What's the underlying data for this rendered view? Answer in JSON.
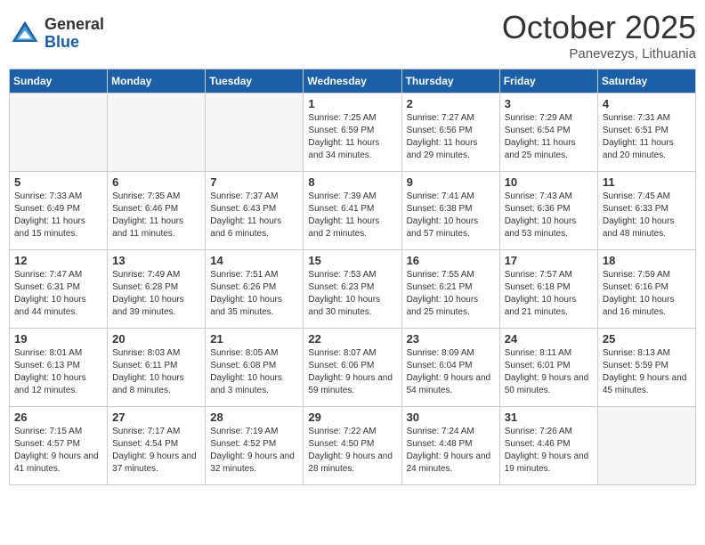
{
  "header": {
    "logo_general": "General",
    "logo_blue": "Blue",
    "month": "October 2025",
    "location": "Panevezys, Lithuania"
  },
  "weekdays": [
    "Sunday",
    "Monday",
    "Tuesday",
    "Wednesday",
    "Thursday",
    "Friday",
    "Saturday"
  ],
  "weeks": [
    [
      {
        "day": "",
        "empty": true
      },
      {
        "day": "",
        "empty": true
      },
      {
        "day": "",
        "empty": true
      },
      {
        "day": "1",
        "sunrise": "7:25 AM",
        "sunset": "6:59 PM",
        "daylight": "11 hours and 34 minutes."
      },
      {
        "day": "2",
        "sunrise": "7:27 AM",
        "sunset": "6:56 PM",
        "daylight": "11 hours and 29 minutes."
      },
      {
        "day": "3",
        "sunrise": "7:29 AM",
        "sunset": "6:54 PM",
        "daylight": "11 hours and 25 minutes."
      },
      {
        "day": "4",
        "sunrise": "7:31 AM",
        "sunset": "6:51 PM",
        "daylight": "11 hours and 20 minutes."
      }
    ],
    [
      {
        "day": "5",
        "sunrise": "7:33 AM",
        "sunset": "6:49 PM",
        "daylight": "11 hours and 15 minutes."
      },
      {
        "day": "6",
        "sunrise": "7:35 AM",
        "sunset": "6:46 PM",
        "daylight": "11 hours and 11 minutes."
      },
      {
        "day": "7",
        "sunrise": "7:37 AM",
        "sunset": "6:43 PM",
        "daylight": "11 hours and 6 minutes."
      },
      {
        "day": "8",
        "sunrise": "7:39 AM",
        "sunset": "6:41 PM",
        "daylight": "11 hours and 2 minutes."
      },
      {
        "day": "9",
        "sunrise": "7:41 AM",
        "sunset": "6:38 PM",
        "daylight": "10 hours and 57 minutes."
      },
      {
        "day": "10",
        "sunrise": "7:43 AM",
        "sunset": "6:36 PM",
        "daylight": "10 hours and 53 minutes."
      },
      {
        "day": "11",
        "sunrise": "7:45 AM",
        "sunset": "6:33 PM",
        "daylight": "10 hours and 48 minutes."
      }
    ],
    [
      {
        "day": "12",
        "sunrise": "7:47 AM",
        "sunset": "6:31 PM",
        "daylight": "10 hours and 44 minutes."
      },
      {
        "day": "13",
        "sunrise": "7:49 AM",
        "sunset": "6:28 PM",
        "daylight": "10 hours and 39 minutes."
      },
      {
        "day": "14",
        "sunrise": "7:51 AM",
        "sunset": "6:26 PM",
        "daylight": "10 hours and 35 minutes."
      },
      {
        "day": "15",
        "sunrise": "7:53 AM",
        "sunset": "6:23 PM",
        "daylight": "10 hours and 30 minutes."
      },
      {
        "day": "16",
        "sunrise": "7:55 AM",
        "sunset": "6:21 PM",
        "daylight": "10 hours and 25 minutes."
      },
      {
        "day": "17",
        "sunrise": "7:57 AM",
        "sunset": "6:18 PM",
        "daylight": "10 hours and 21 minutes."
      },
      {
        "day": "18",
        "sunrise": "7:59 AM",
        "sunset": "6:16 PM",
        "daylight": "10 hours and 16 minutes."
      }
    ],
    [
      {
        "day": "19",
        "sunrise": "8:01 AM",
        "sunset": "6:13 PM",
        "daylight": "10 hours and 12 minutes."
      },
      {
        "day": "20",
        "sunrise": "8:03 AM",
        "sunset": "6:11 PM",
        "daylight": "10 hours and 8 minutes."
      },
      {
        "day": "21",
        "sunrise": "8:05 AM",
        "sunset": "6:08 PM",
        "daylight": "10 hours and 3 minutes."
      },
      {
        "day": "22",
        "sunrise": "8:07 AM",
        "sunset": "6:06 PM",
        "daylight": "9 hours and 59 minutes."
      },
      {
        "day": "23",
        "sunrise": "8:09 AM",
        "sunset": "6:04 PM",
        "daylight": "9 hours and 54 minutes."
      },
      {
        "day": "24",
        "sunrise": "8:11 AM",
        "sunset": "6:01 PM",
        "daylight": "9 hours and 50 minutes."
      },
      {
        "day": "25",
        "sunrise": "8:13 AM",
        "sunset": "5:59 PM",
        "daylight": "9 hours and 45 minutes."
      }
    ],
    [
      {
        "day": "26",
        "sunrise": "7:15 AM",
        "sunset": "4:57 PM",
        "daylight": "9 hours and 41 minutes."
      },
      {
        "day": "27",
        "sunrise": "7:17 AM",
        "sunset": "4:54 PM",
        "daylight": "9 hours and 37 minutes."
      },
      {
        "day": "28",
        "sunrise": "7:19 AM",
        "sunset": "4:52 PM",
        "daylight": "9 hours and 32 minutes."
      },
      {
        "day": "29",
        "sunrise": "7:22 AM",
        "sunset": "4:50 PM",
        "daylight": "9 hours and 28 minutes."
      },
      {
        "day": "30",
        "sunrise": "7:24 AM",
        "sunset": "4:48 PM",
        "daylight": "9 hours and 24 minutes."
      },
      {
        "day": "31",
        "sunrise": "7:26 AM",
        "sunset": "4:46 PM",
        "daylight": "9 hours and 19 minutes."
      },
      {
        "day": "",
        "empty": true
      }
    ]
  ]
}
